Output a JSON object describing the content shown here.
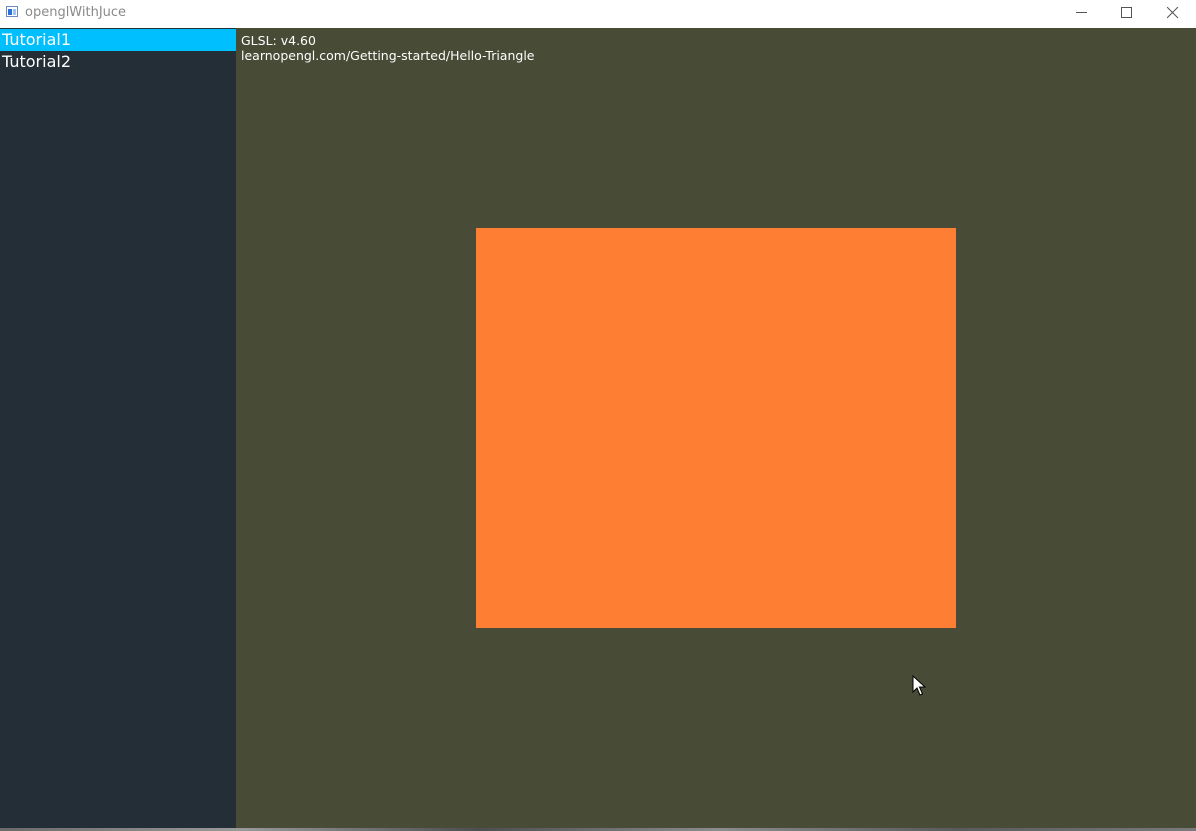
{
  "window": {
    "title": "openglWithJuce"
  },
  "sidebar": {
    "items": [
      {
        "label": "Tutorial1",
        "selected": true
      },
      {
        "label": "Tutorial2",
        "selected": false
      }
    ],
    "background": "#232e37",
    "selected_color": "#00bfff"
  },
  "gl_view": {
    "info_lines": [
      "GLSL: v4.60",
      "learnopengl.com/Getting-started/Hello-Triangle"
    ],
    "background": "#484b35",
    "quad_color": "#fe7f33"
  },
  "icons": {
    "app": "app-icon",
    "minimize": "minimize-icon",
    "maximize": "maximize-icon",
    "close": "close-icon",
    "cursor": "mouse-cursor-icon"
  }
}
